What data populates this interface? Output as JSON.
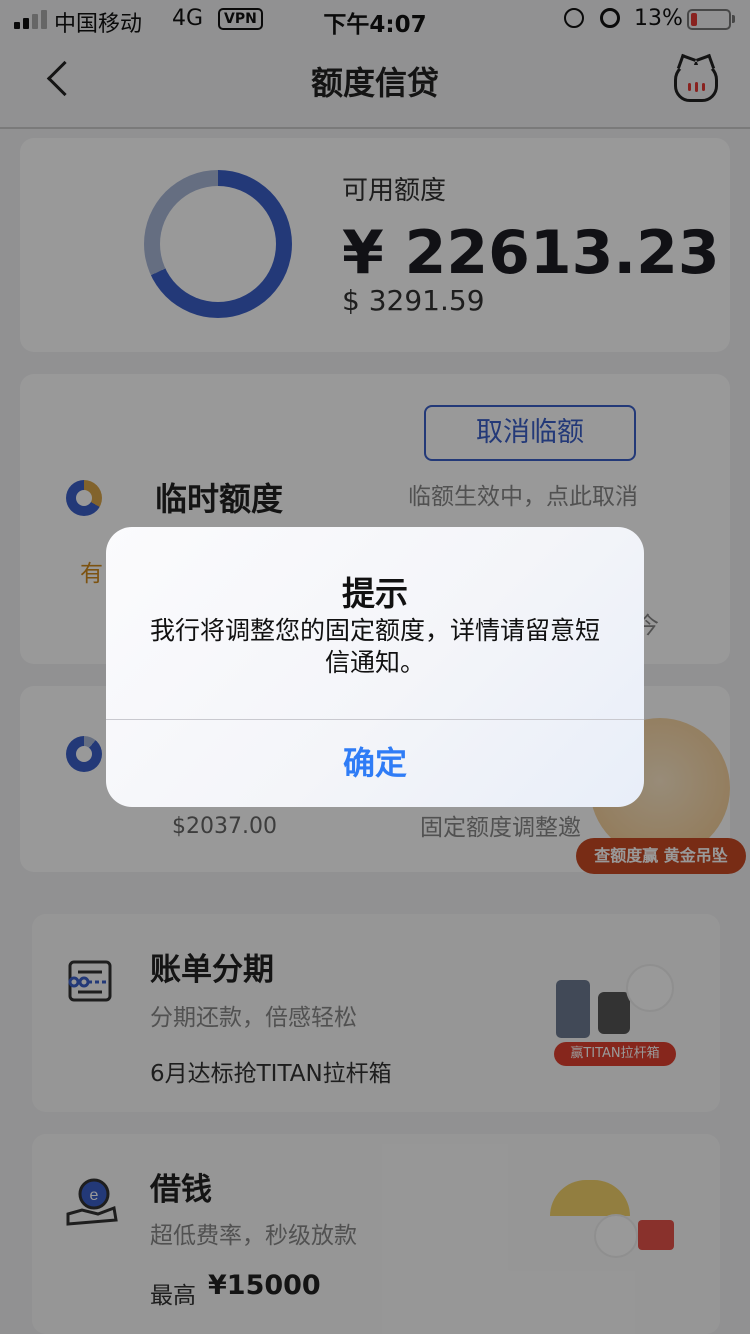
{
  "status_bar": {
    "carrier": "中国移动",
    "network": "4G",
    "vpn": "VPN",
    "time": "下午4:07",
    "battery": "13%"
  },
  "nav": {
    "title": "额度信贷"
  },
  "credit": {
    "label": "可用额度",
    "cny_amount": "¥ 22613.23",
    "usd_amount": "$ 3291.59"
  },
  "temp": {
    "title": "临时额度",
    "cancel_button": "取消临额",
    "hint": "临额生效中，点此取消",
    "partial_left": "有",
    "partial_right": "今"
  },
  "fixed": {
    "usd_amount": "$2037.00",
    "hint": "固定额度调整邀",
    "promo": "查额度赢 黄金吊坠"
  },
  "installment": {
    "title": "账单分期",
    "subtitle": "分期还款，倍感轻松",
    "promo": "6月达标抢TITAN拉杆箱",
    "tag": "赢TITAN拉杆箱"
  },
  "loan": {
    "title": "借钱",
    "subtitle": "超低费率，秒级放款",
    "max_label": "最高",
    "max_amount": "¥15000"
  },
  "dialog": {
    "title": "提示",
    "message": "我行将调整您的固定额度，详情请留意短信通知。",
    "ok_button": "确定"
  },
  "colors": {
    "accent": "#3b5fc9",
    "dialog_button": "#2f7cf6",
    "promo_red": "#e0402f"
  }
}
